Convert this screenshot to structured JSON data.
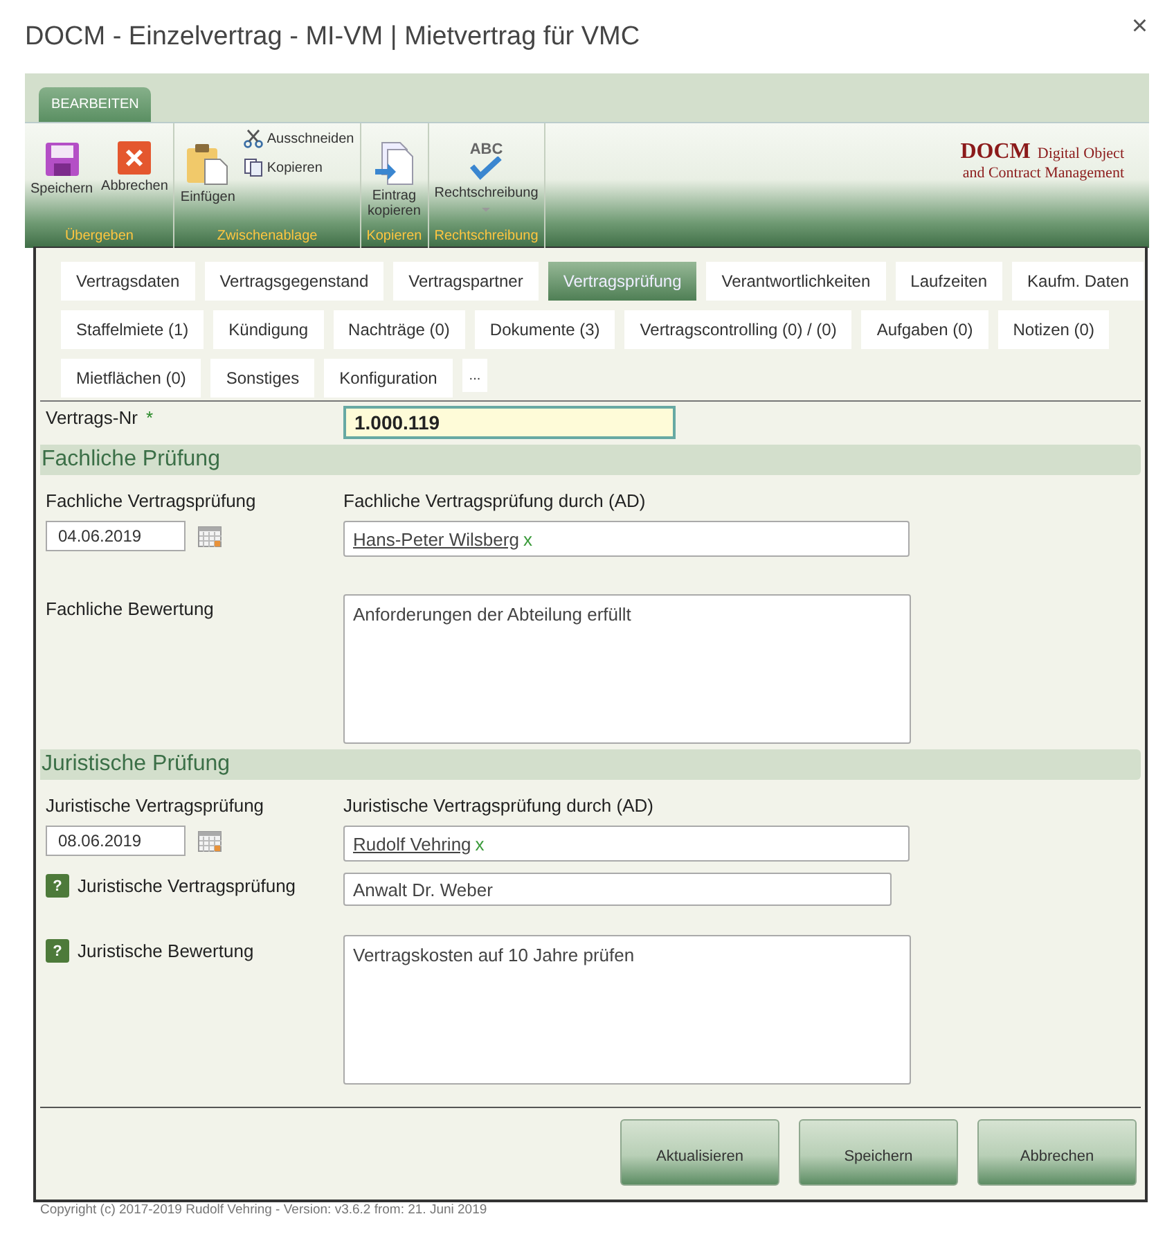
{
  "window": {
    "title": "DOCM - Einzelvertrag - MI-VM | Mietvertrag für VMC",
    "close": "×"
  },
  "ribbon": {
    "tabs": [
      {
        "label": "BEARBEITEN",
        "selected": true
      }
    ],
    "groups": [
      {
        "label": "Übergeben",
        "buttons": [
          {
            "kind": "save",
            "label": "Speichern"
          },
          {
            "kind": "cancel",
            "label": "Abbrechen"
          }
        ]
      },
      {
        "label": "Zwischenablage",
        "buttons": [
          {
            "kind": "paste",
            "label": "Einfügen"
          },
          {
            "kind": "cut",
            "label": "Ausschneiden"
          },
          {
            "kind": "copy",
            "label": "Kopieren"
          }
        ]
      },
      {
        "label": "Kopieren",
        "buttons": [
          {
            "kind": "copy-entry",
            "label": "Eintrag kopieren"
          }
        ]
      },
      {
        "label": "Rechtschreibung",
        "buttons": [
          {
            "kind": "spelling",
            "label": "Rechtschreibung",
            "icon_text": "ABC"
          }
        ]
      }
    ],
    "logo": {
      "name": "DOCM",
      "line_1": "Digital Object",
      "line_2": "and Contract Management"
    }
  },
  "tabs": [
    [
      {
        "label": "Vertragsdaten",
        "selected": false
      },
      {
        "label": "Vertragsgegenstand",
        "selected": false
      },
      {
        "label": "Vertragspartner",
        "selected": false
      },
      {
        "label": "Vertragsprüfung",
        "selected": true
      },
      {
        "label": "Verantwortlichkeiten",
        "selected": false
      },
      {
        "label": "Laufzeiten",
        "selected": false
      },
      {
        "label": "Kaufm. Daten",
        "selected": false
      }
    ],
    [
      {
        "label": "Staffelmiete (1)",
        "selected": false
      },
      {
        "label": "Kündigung",
        "selected": false
      },
      {
        "label": "Nachträge (0)",
        "selected": false
      },
      {
        "label": "Dokumente (3)",
        "selected": false
      },
      {
        "label": "Vertragscontrolling (0) / (0)",
        "selected": false
      },
      {
        "label": "Aufgaben (0)",
        "selected": false
      },
      {
        "label": "Notizen (0)",
        "selected": false
      }
    ],
    [
      {
        "label": "Mietflächen (0)",
        "selected": false
      },
      {
        "label": "Sonstiges",
        "selected": false
      },
      {
        "label": "Konfiguration",
        "selected": false
      },
      {
        "label": "...",
        "selected": false
      }
    ]
  ],
  "contract_number": {
    "label": "Vertrags-Nr",
    "required_mark": "*",
    "value": "1.000.119"
  },
  "sections": [
    {
      "title": "Fachliche Prüfung",
      "rows": [
        {
          "kind": "date-person",
          "label": "Fachliche Vertragsprüfung",
          "date": "04.06.2019",
          "person_label": "Fachliche Vertragsprüfung durch (AD)",
          "person": "Hans-Peter Wilsberg",
          "remove": "x"
        },
        {
          "kind": "textarea",
          "label": "Fachliche Bewertung",
          "value": "Anforderungen der Abteilung erfüllt"
        }
      ]
    },
    {
      "title": "Juristische Prüfung",
      "rows": [
        {
          "kind": "date-person",
          "label": "Juristische Vertragsprüfung",
          "date": "08.06.2019",
          "person_label": "Juristische Vertragsprüfung durch (AD)",
          "person": "Rudolf Vehring",
          "remove": "x"
        },
        {
          "kind": "text",
          "label": "Juristische Vertragsprüfung",
          "value": "Anwalt Dr. Weber",
          "help": "?"
        },
        {
          "kind": "textarea",
          "label": "Juristische Bewertung",
          "value": "Vertragskosten auf 10 Jahre prüfen",
          "help": "?"
        }
      ]
    }
  ],
  "buttons": [
    "Aktualisieren",
    "Speichern",
    "Abbrechen"
  ],
  "footer": "Copyright (c) 2017-2019 Rudolf Vehring - Version: v3.6.2 from: 21. Juni 2019"
}
